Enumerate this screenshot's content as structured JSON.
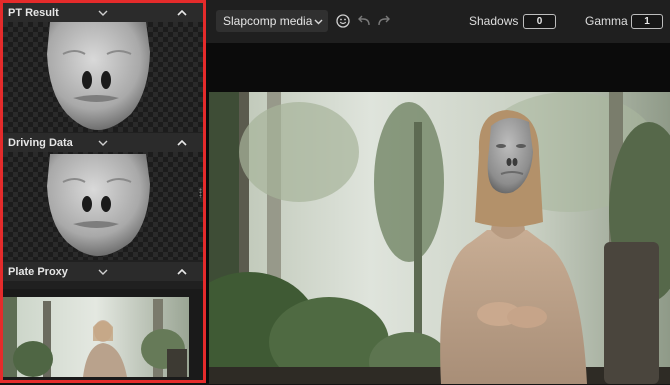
{
  "sections": [
    {
      "id": "pt_result",
      "title": "PT Result"
    },
    {
      "id": "driving_data",
      "title": "Driving Data"
    },
    {
      "id": "plate_proxy",
      "title": "Plate Proxy"
    }
  ],
  "toolbar": {
    "media_select": {
      "value": "Slapcomp media"
    },
    "shadows": {
      "label": "Shadows",
      "value": "0"
    },
    "gamma": {
      "label": "Gamma",
      "value": "1"
    }
  },
  "icons": {
    "dropdown": "chevron-down-icon",
    "collapse": "chevron-up-icon",
    "emoji": "smiley-icon",
    "undo": "undo-icon",
    "redo": "redo-icon"
  },
  "colors": {
    "selection_outline": "#e52b2b",
    "panel_bg": "#202020",
    "toolbar_bg": "#1f1f1f",
    "viewer_bg": "#0b0b0b"
  }
}
